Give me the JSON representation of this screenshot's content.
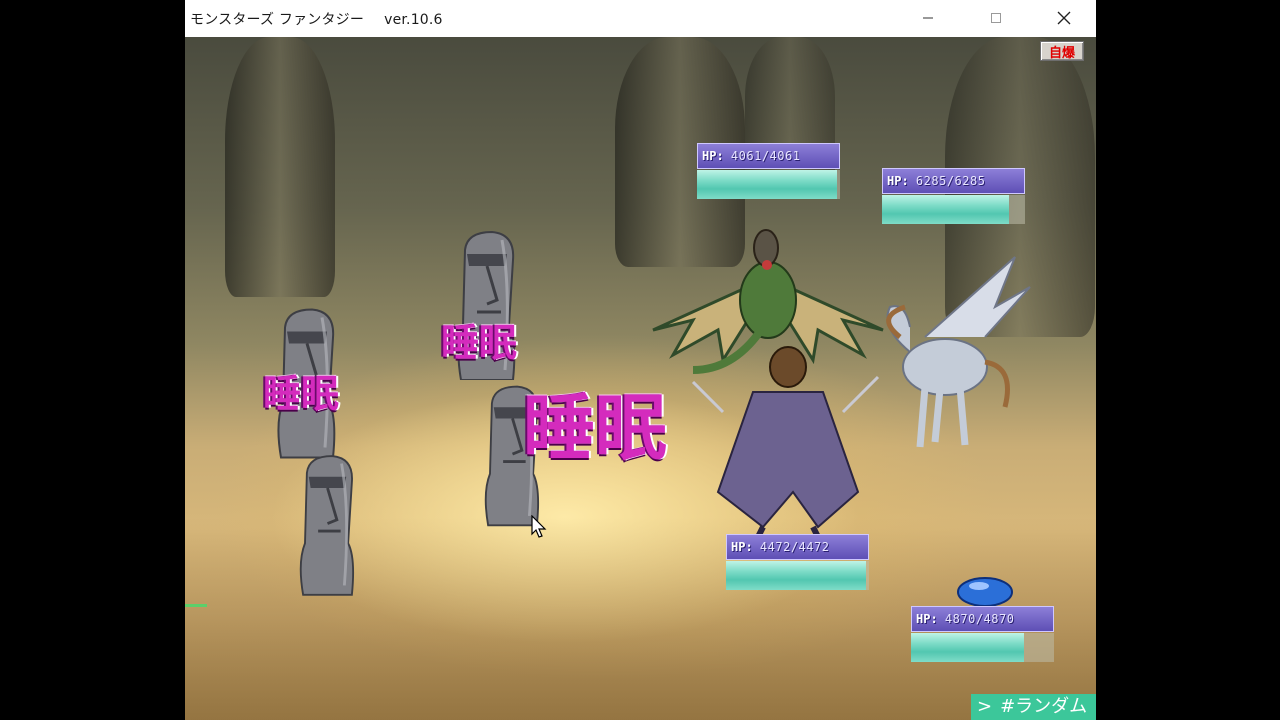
{
  "window": {
    "title": "モンスターズ ファンタジー",
    "version": "ver.10.6",
    "controls": {
      "minimize": "minimize-icon",
      "maximize": "maximize-icon",
      "close": "close-icon"
    }
  },
  "game": {
    "self_destruct_label": "自爆",
    "random_tag": {
      "arrow": ">",
      "label": "#ランダム"
    },
    "enemies": [
      {
        "name": "moai-1",
        "status": "睡眠"
      },
      {
        "name": "moai-2",
        "status": "睡眠"
      },
      {
        "name": "moai-3",
        "status": ""
      },
      {
        "name": "moai-4",
        "status": "睡眠"
      }
    ],
    "party": [
      {
        "name": "dragon",
        "hp_label": "HP:",
        "hp_text": "4061/4061",
        "hp": 4061,
        "hp_max": 4061
      },
      {
        "name": "pegasus",
        "hp_label": "HP:",
        "hp_text": "6285/6285",
        "hp": 6285,
        "hp_max": 6285
      },
      {
        "name": "samurai",
        "hp_label": "HP:",
        "hp_text": "4472/4472",
        "hp": 4472,
        "hp_max": 4472
      },
      {
        "name": "slime",
        "hp_label": "HP:",
        "hp_text": "4870/4870",
        "hp": 4870,
        "hp_max": 4870
      }
    ],
    "colors": {
      "hp_fill": "#7fdcc8",
      "hp_label_bg": "#6a5cc4",
      "status_text": "#d42bbd",
      "self_destruct_text": "#e00000"
    }
  }
}
